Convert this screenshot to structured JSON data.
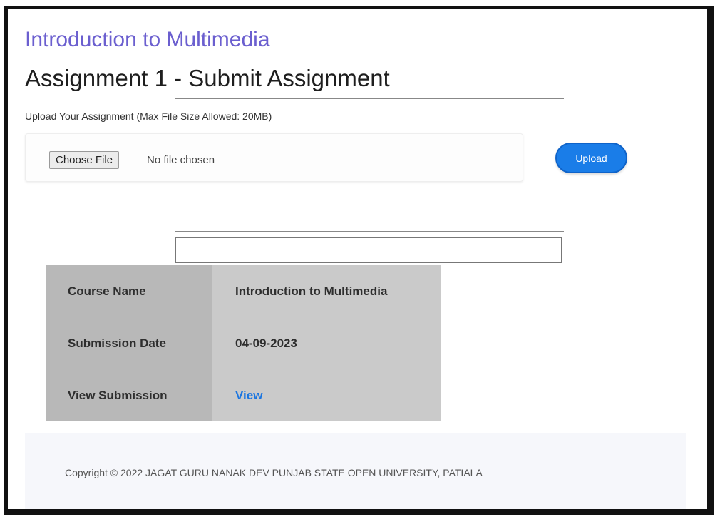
{
  "course": {
    "title": "Introduction to Multimedia"
  },
  "page": {
    "heading": "Assignment 1 - Submit Assignment"
  },
  "upload": {
    "note": "Upload Your Assignment (Max File Size Allowed: 20MB)",
    "choose_label": "Choose File",
    "no_file_text": "No file chosen",
    "button_label": "Upload"
  },
  "text_field": {
    "value": ""
  },
  "details": {
    "rows": [
      {
        "label": "Course Name",
        "value": "Introduction to Multimedia"
      },
      {
        "label": "Submission Date",
        "value": "04-09-2023"
      },
      {
        "label": "View Submission",
        "value": "View"
      }
    ]
  },
  "footer": {
    "copyright": "Copyright © 2022 JAGAT GURU NANAK DEV PUNJAB STATE OPEN UNIVERSITY, PATIALA"
  },
  "colors": {
    "course_title": "#6b5fcf",
    "upload_button": "#1a7de8",
    "link": "#1a75e0",
    "table_label_bg": "#b8b8b8",
    "table_value_bg": "#cacaca"
  }
}
